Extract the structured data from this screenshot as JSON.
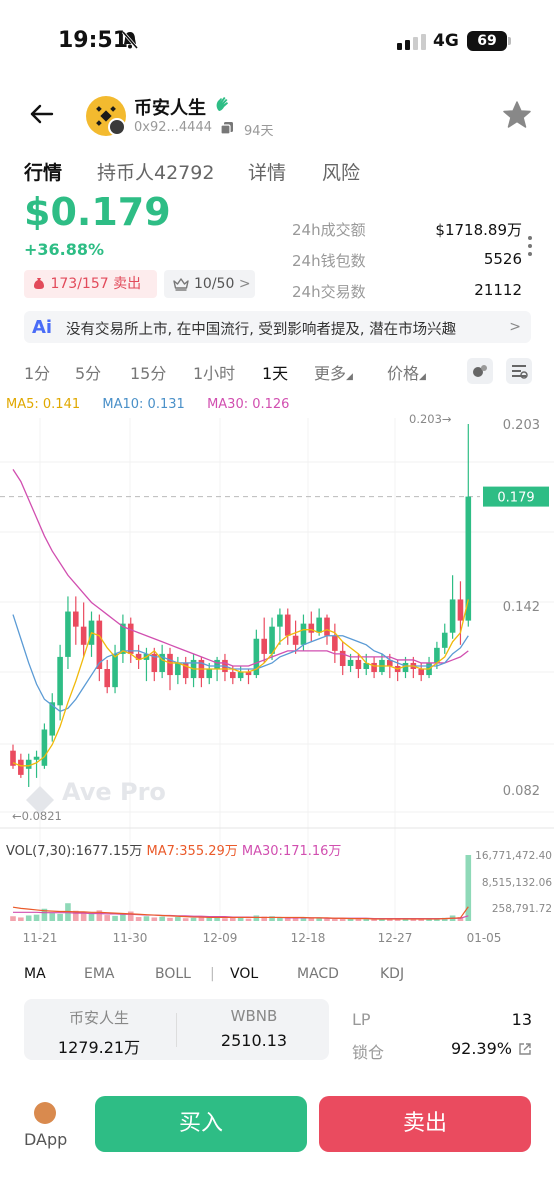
{
  "status_bar": {
    "time": "19:51",
    "network": "4G",
    "battery": "69"
  },
  "header": {
    "token_name": "币安人生",
    "address": "0x92...4444",
    "age": "94天"
  },
  "tabs": [
    "行情",
    "持币人42792",
    "详情",
    "风险"
  ],
  "price": {
    "value": "$0.179",
    "change": "+36.88%",
    "buys": "173",
    "sep": "/",
    "sells": "157",
    "sell_word": " 卖出",
    "rank": "10/50"
  },
  "stats": [
    {
      "label": "24h成交额",
      "value": "$1718.89万"
    },
    {
      "label": "24h钱包数",
      "value": "5526"
    },
    {
      "label": "24h交易数",
      "value": "21112"
    }
  ],
  "ai_banner": {
    "icon": "Ai",
    "text": "没有交易所上市, 在中国流行, 受到影响者提及, 潜在市场兴趣"
  },
  "intervals": [
    "1分",
    "5分",
    "15分",
    "1小时",
    "1天",
    "更多",
    "价格"
  ],
  "ma_legend": {
    "ma5": "MA5: 0.141",
    "ma10": "MA10: 0.131",
    "ma30": "MA30: 0.126"
  },
  "colors": {
    "up": "#2ebd85",
    "down": "#ea4b5f",
    "ma5": "#f0b90b",
    "ma10": "#5b9bd5",
    "ma30": "#d14fb0"
  },
  "chart_data": {
    "type": "candlestick",
    "price_axis_labels": [
      "0.203",
      "0.142",
      "0.082"
    ],
    "current_price_label": "0.179",
    "high_marker": "0.203→",
    "low_marker": "←0.0821",
    "watermark": "Ave Pro",
    "x_labels": [
      "11-21",
      "11-30",
      "12-09",
      "12-18",
      "12-27",
      "01-05"
    ],
    "candles": [
      [
        0.095,
        0.09,
        0.097,
        0.089
      ],
      [
        0.092,
        0.087,
        0.094,
        0.086
      ],
      [
        0.089,
        0.092,
        0.094,
        0.083
      ],
      [
        0.092,
        0.093,
        0.095,
        0.086
      ],
      [
        0.09,
        0.102,
        0.104,
        0.089
      ],
      [
        0.1,
        0.111,
        0.114,
        0.098
      ],
      [
        0.11,
        0.126,
        0.13,
        0.105
      ],
      [
        0.126,
        0.141,
        0.146,
        0.122
      ],
      [
        0.141,
        0.136,
        0.146,
        0.13
      ],
      [
        0.136,
        0.13,
        0.144,
        0.126
      ],
      [
        0.13,
        0.138,
        0.141,
        0.126
      ],
      [
        0.138,
        0.122,
        0.14,
        0.118
      ],
      [
        0.122,
        0.116,
        0.125,
        0.114
      ],
      [
        0.116,
        0.127,
        0.13,
        0.114
      ],
      [
        0.127,
        0.137,
        0.14,
        0.124
      ],
      [
        0.137,
        0.127,
        0.139,
        0.124
      ],
      [
        0.127,
        0.125,
        0.13,
        0.122
      ],
      [
        0.125,
        0.127,
        0.129,
        0.118
      ],
      [
        0.127,
        0.121,
        0.129,
        0.118
      ],
      [
        0.121,
        0.127,
        0.13,
        0.119
      ],
      [
        0.127,
        0.12,
        0.129,
        0.115
      ],
      [
        0.12,
        0.124,
        0.126,
        0.117
      ],
      [
        0.124,
        0.119,
        0.126,
        0.117
      ],
      [
        0.119,
        0.125,
        0.127,
        0.116
      ],
      [
        0.125,
        0.119,
        0.126,
        0.116
      ],
      [
        0.119,
        0.122,
        0.124,
        0.117
      ],
      [
        0.122,
        0.125,
        0.126,
        0.118
      ],
      [
        0.125,
        0.121,
        0.127,
        0.118
      ],
      [
        0.121,
        0.119,
        0.123,
        0.117
      ],
      [
        0.119,
        0.121,
        0.123,
        0.118
      ],
      [
        0.121,
        0.12,
        0.122,
        0.117
      ],
      [
        0.12,
        0.132,
        0.135,
        0.119
      ],
      [
        0.132,
        0.127,
        0.139,
        0.124
      ],
      [
        0.127,
        0.136,
        0.139,
        0.125
      ],
      [
        0.136,
        0.14,
        0.142,
        0.13
      ],
      [
        0.14,
        0.133,
        0.142,
        0.13
      ],
      [
        0.133,
        0.13,
        0.138,
        0.127
      ],
      [
        0.13,
        0.137,
        0.14,
        0.128
      ],
      [
        0.137,
        0.134,
        0.141,
        0.131
      ],
      [
        0.134,
        0.139,
        0.142,
        0.133
      ],
      [
        0.139,
        0.133,
        0.14,
        0.13
      ],
      [
        0.133,
        0.128,
        0.137,
        0.124
      ],
      [
        0.128,
        0.123,
        0.131,
        0.12
      ],
      [
        0.123,
        0.125,
        0.127,
        0.121
      ],
      [
        0.125,
        0.122,
        0.127,
        0.119
      ],
      [
        0.122,
        0.124,
        0.127,
        0.12
      ],
      [
        0.124,
        0.121,
        0.126,
        0.119
      ],
      [
        0.121,
        0.125,
        0.127,
        0.12
      ],
      [
        0.125,
        0.123,
        0.127,
        0.119
      ],
      [
        0.123,
        0.121,
        0.125,
        0.118
      ],
      [
        0.121,
        0.124,
        0.126,
        0.119
      ],
      [
        0.124,
        0.122,
        0.126,
        0.119
      ],
      [
        0.122,
        0.12,
        0.124,
        0.118
      ],
      [
        0.12,
        0.124,
        0.126,
        0.119
      ],
      [
        0.124,
        0.129,
        0.131,
        0.122
      ],
      [
        0.129,
        0.134,
        0.137,
        0.127
      ],
      [
        0.134,
        0.145,
        0.153,
        0.132
      ],
      [
        0.145,
        0.138,
        0.151,
        0.13
      ],
      [
        0.138,
        0.179,
        0.203,
        0.136
      ]
    ],
    "ma5": [
      0.091,
      0.09,
      0.09,
      0.091,
      0.093,
      0.097,
      0.103,
      0.111,
      0.118,
      0.126,
      0.134,
      0.133,
      0.129,
      0.126,
      0.128,
      0.127,
      0.125,
      0.126,
      0.128,
      0.125,
      0.124,
      0.124,
      0.123,
      0.122,
      0.122,
      0.122,
      0.122,
      0.122,
      0.122,
      0.121,
      0.121,
      0.122,
      0.124,
      0.127,
      0.131,
      0.133,
      0.134,
      0.135,
      0.135,
      0.134,
      0.135,
      0.134,
      0.131,
      0.129,
      0.127,
      0.124,
      0.123,
      0.123,
      0.123,
      0.122,
      0.123,
      0.123,
      0.122,
      0.122,
      0.124,
      0.126,
      0.131,
      0.134,
      0.145
    ],
    "ma10": [
      0.14,
      0.132,
      0.124,
      0.117,
      0.112,
      0.11,
      0.108,
      0.109,
      0.112,
      0.116,
      0.12,
      0.124,
      0.126,
      0.127,
      0.128,
      0.128,
      0.128,
      0.127,
      0.126,
      0.126,
      0.125,
      0.124,
      0.124,
      0.124,
      0.124,
      0.123,
      0.123,
      0.123,
      0.122,
      0.122,
      0.122,
      0.122,
      0.123,
      0.124,
      0.126,
      0.127,
      0.128,
      0.13,
      0.131,
      0.132,
      0.133,
      0.133,
      0.133,
      0.132,
      0.131,
      0.13,
      0.128,
      0.127,
      0.125,
      0.124,
      0.123,
      0.123,
      0.123,
      0.123,
      0.123,
      0.124,
      0.127,
      0.129,
      0.133
    ],
    "ma30": [
      0.188,
      0.184,
      0.178,
      0.172,
      0.166,
      0.161,
      0.157,
      0.153,
      0.15,
      0.147,
      0.144,
      0.142,
      0.14,
      0.138,
      0.136,
      0.135,
      0.134,
      0.133,
      0.132,
      0.131,
      0.13,
      0.129,
      0.128,
      0.127,
      0.126,
      0.125,
      0.124,
      0.124,
      0.123,
      0.123,
      0.123,
      0.124,
      0.125,
      0.126,
      0.127,
      0.128,
      0.128,
      0.128,
      0.128,
      0.128,
      0.128,
      0.127,
      0.127,
      0.126,
      0.126,
      0.126,
      0.126,
      0.126,
      0.126,
      0.125,
      0.125,
      0.125,
      0.124,
      0.124,
      0.124,
      0.124,
      0.125,
      0.126,
      0.128
    ],
    "volume_axis_labels": [
      "16,771,472.40",
      "8,515,132.06",
      "258,791.72"
    ],
    "volume": [
      1.2,
      0.9,
      1.4,
      1.6,
      3.1,
      2.0,
      1.8,
      4.5,
      2.6,
      2.2,
      1.9,
      2.7,
      1.5,
      1.3,
      1.7,
      2.4,
      1.0,
      1.2,
      0.9,
      1.1,
      0.8,
      1.0,
      0.7,
      0.8,
      0.9,
      1.0,
      0.8,
      0.7,
      0.9,
      0.8,
      0.6,
      1.4,
      1.1,
      1.2,
      1.0,
      0.9,
      0.8,
      0.9,
      0.7,
      0.8,
      0.6,
      0.5,
      0.6,
      0.5,
      0.5,
      0.6,
      0.4,
      0.5,
      0.5,
      0.4,
      0.5,
      0.4,
      0.4,
      0.5,
      0.6,
      0.8,
      1.4,
      1.0,
      16.7
    ],
    "vol_ma7": [
      3.5,
      3.2,
      3.0,
      2.8,
      2.6,
      2.5,
      2.4,
      2.4,
      2.3,
      2.3,
      2.2,
      2.2,
      2.1,
      2.0,
      1.9,
      1.8,
      1.7,
      1.6,
      1.5,
      1.4,
      1.3,
      1.2,
      1.1,
      1.0,
      1.0,
      0.9,
      0.9,
      0.9,
      0.9,
      0.9,
      0.9,
      0.9,
      0.9,
      0.9,
      0.9,
      0.9,
      0.9,
      0.9,
      0.8,
      0.8,
      0.8,
      0.7,
      0.7,
      0.6,
      0.6,
      0.6,
      0.5,
      0.5,
      0.5,
      0.5,
      0.5,
      0.5,
      0.5,
      0.5,
      0.5,
      0.6,
      0.7,
      0.8,
      3.6
    ],
    "vol_ma30": [
      2.2,
      2.2,
      2.2,
      2.2,
      2.1,
      2.1,
      2.1,
      2.1,
      2.0,
      2.0,
      1.9,
      1.9,
      1.8,
      1.8,
      1.7,
      1.7,
      1.6,
      1.5,
      1.5,
      1.4,
      1.4,
      1.3,
      1.3,
      1.2,
      1.2,
      1.1,
      1.1,
      1.1,
      1.0,
      1.0,
      1.0,
      0.9,
      0.9,
      0.9,
      0.9,
      0.8,
      0.8,
      0.8,
      0.8,
      0.8,
      0.7,
      0.7,
      0.7,
      0.7,
      0.7,
      0.7,
      0.6,
      0.6,
      0.6,
      0.6,
      0.6,
      0.6,
      0.6,
      0.6,
      0.6,
      0.6,
      0.7,
      0.7,
      1.3
    ]
  },
  "vol_legend": {
    "vol": "VOL(7,30):1677.15万",
    "ma7": "MA7:355.29万",
    "ma30": "MA30:171.16万"
  },
  "indicators": [
    "MA",
    "EMA",
    "BOLL",
    "|",
    "VOL",
    "MACD",
    "KDJ"
  ],
  "pool": {
    "token_a": "币安人生",
    "amount_a": "1279.21万",
    "token_b": "WBNB",
    "amount_b": "2510.13"
  },
  "lp": {
    "label": "LP",
    "value": "13",
    "lock_label": "锁仓",
    "lock_value": "92.39%"
  },
  "bottom": {
    "dapp": "DApp",
    "buy": "买入",
    "sell": "卖出"
  }
}
